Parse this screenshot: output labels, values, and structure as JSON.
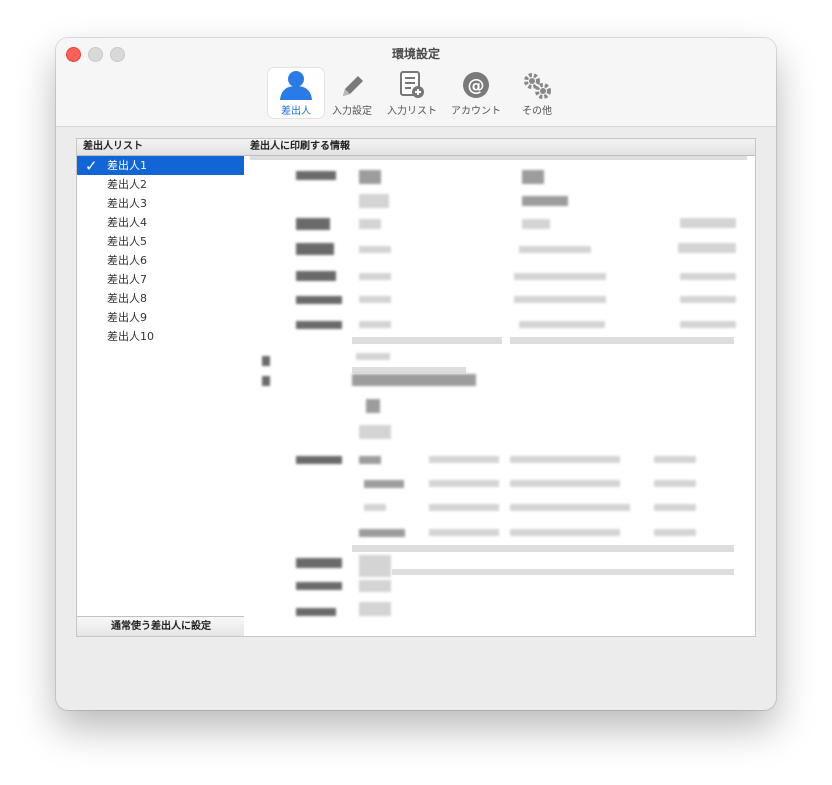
{
  "window": {
    "title": "環境設定"
  },
  "toolbar": {
    "items": [
      {
        "label": "差出人",
        "icon": "person-icon",
        "active": true
      },
      {
        "label": "入力設定",
        "icon": "pencil-icon",
        "active": false
      },
      {
        "label": "入力リスト",
        "icon": "list-add-icon",
        "active": false
      },
      {
        "label": "アカウント",
        "icon": "at-sign-icon",
        "active": false
      },
      {
        "label": "その他",
        "icon": "gears-icon",
        "active": false
      }
    ]
  },
  "sender_list": {
    "header": "差出人リスト",
    "items": [
      "差出人1",
      "差出人2",
      "差出人3",
      "差出人4",
      "差出人5",
      "差出人6",
      "差出人7",
      "差出人8",
      "差出人9",
      "差出人10"
    ],
    "selected_index": 0,
    "set_default_label": "通常使う差出人に設定"
  },
  "info_panel": {
    "header": "差出人に印刷する情報"
  },
  "colors": {
    "accent": "#1265d4",
    "close": "#ff5f57"
  }
}
